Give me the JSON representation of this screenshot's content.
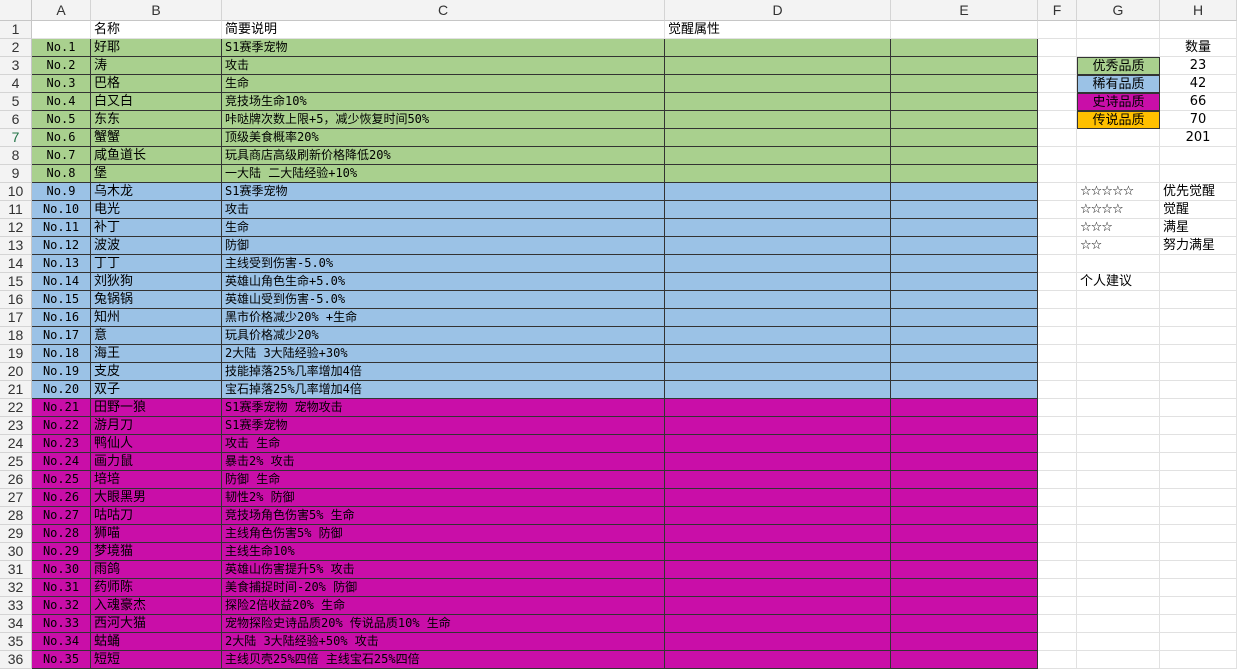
{
  "sheet": {
    "columns": [
      "A",
      "B",
      "C",
      "D",
      "E",
      "F",
      "G",
      "H"
    ],
    "row_numbers": [
      "1",
      "2",
      "3",
      "4",
      "5",
      "6",
      "7",
      "8",
      "9",
      "10",
      "11",
      "12",
      "13",
      "14",
      "15",
      "16",
      "17",
      "18",
      "19",
      "20",
      "21",
      "22",
      "23",
      "24",
      "25",
      "26",
      "27",
      "28",
      "29",
      "30",
      "31",
      "32",
      "33",
      "34",
      "35",
      "36"
    ],
    "selected_row": "7",
    "headers": {
      "name": "名称",
      "desc": "简要说明",
      "awaken": "觉醒属性"
    },
    "colors": {
      "green": "#a9d08e",
      "blue": "#9bc2e6",
      "magenta": "#c90ea8",
      "orange": "#ffc000"
    },
    "pets": [
      {
        "no": "No.1",
        "name": "好耶",
        "desc": "S1赛季宠物",
        "quality": "green"
      },
      {
        "no": "No.2",
        "name": "涛",
        "desc": "攻击",
        "quality": "green"
      },
      {
        "no": "No.3",
        "name": "巴格",
        "desc": "生命",
        "quality": "green"
      },
      {
        "no": "No.4",
        "name": "白又白",
        "desc": "竞技场生命10%",
        "quality": "green"
      },
      {
        "no": "No.5",
        "name": "东东",
        "desc": "咔哒牌次数上限+5，减少恢复时间50%",
        "quality": "green"
      },
      {
        "no": "No.6",
        "name": "蟹蟹",
        "desc": "顶级美食概率20%",
        "quality": "green"
      },
      {
        "no": "No.7",
        "name": "咸鱼道长",
        "desc": "玩具商店高级刷新价格降低20%",
        "quality": "green"
      },
      {
        "no": "No.8",
        "name": "堡",
        "desc": "一大陆  二大陆经验+10%",
        "quality": "green"
      },
      {
        "no": "No.9",
        "name": "乌木龙",
        "desc": "S1赛季宠物",
        "quality": "blue"
      },
      {
        "no": "No.10",
        "name": "电光",
        "desc": "攻击",
        "quality": "blue"
      },
      {
        "no": "No.11",
        "name": "补丁",
        "desc": "生命",
        "quality": "blue"
      },
      {
        "no": "No.12",
        "name": "波波",
        "desc": "防御",
        "quality": "blue"
      },
      {
        "no": "No.13",
        "name": "丁丁",
        "desc": "主线受到伤害-5.0%",
        "quality": "blue"
      },
      {
        "no": "No.14",
        "name": "刘狄狗",
        "desc": "英雄山角色生命+5.0%",
        "quality": "blue"
      },
      {
        "no": "No.15",
        "name": "兔锅锅",
        "desc": "英雄山受到伤害-5.0%",
        "quality": "blue"
      },
      {
        "no": "No.16",
        "name": "知州",
        "desc": "黑市价格减少20%    +生命",
        "quality": "blue"
      },
      {
        "no": "No.17",
        "name": "意",
        "desc": "玩具价格减少20%",
        "quality": "blue"
      },
      {
        "no": "No.18",
        "name": "海王",
        "desc": "2大陆 3大陆经验+30%",
        "quality": "blue"
      },
      {
        "no": "No.19",
        "name": "支皮",
        "desc": "技能掉落25%几率增加4倍",
        "quality": "blue"
      },
      {
        "no": "No.20",
        "name": "双子",
        "desc": "宝石掉落25%几率增加4倍",
        "quality": "blue"
      },
      {
        "no": "No.21",
        "name": "田野一狼",
        "desc": "S1赛季宠物 宠物攻击",
        "quality": "magenta"
      },
      {
        "no": "No.22",
        "name": "游月刀",
        "desc": "S1赛季宠物",
        "quality": "magenta"
      },
      {
        "no": "No.23",
        "name": "鸭仙人",
        "desc": "攻击   生命",
        "quality": "magenta"
      },
      {
        "no": "No.24",
        "name": "画力鼠",
        "desc": "暴击2%   攻击",
        "quality": "magenta"
      },
      {
        "no": "No.25",
        "name": "培培",
        "desc": "防御  生命",
        "quality": "magenta"
      },
      {
        "no": "No.26",
        "name": "大眼黑男",
        "desc": "韧性2%  防御",
        "quality": "magenta"
      },
      {
        "no": "No.27",
        "name": "咕咕刀",
        "desc": "竞技场角色伤害5%  生命",
        "quality": "magenta"
      },
      {
        "no": "No.28",
        "name": "狮喵",
        "desc": "主线角色伤害5%  防御",
        "quality": "magenta"
      },
      {
        "no": "No.29",
        "name": "梦境猫",
        "desc": "主线生命10%",
        "quality": "magenta"
      },
      {
        "no": "No.30",
        "name": "雨鸽",
        "desc": "英雄山伤害提升5%  攻击",
        "quality": "magenta"
      },
      {
        "no": "No.31",
        "name": "药师陈",
        "desc": "美食捕捉时间-20%    防御",
        "quality": "magenta"
      },
      {
        "no": "No.32",
        "name": "入魂豪杰",
        "desc": "探险2倍收益20%   生命",
        "quality": "magenta"
      },
      {
        "no": "No.33",
        "name": "西河大猫",
        "desc": "宠物探险史诗品质20% 传说品质10%  生命",
        "quality": "magenta"
      },
      {
        "no": "No.34",
        "name": "蛄蛹",
        "desc": "2大陆 3大陆经验+50% 攻击",
        "quality": "magenta"
      },
      {
        "no": "No.35",
        "name": "短短",
        "desc": "主线贝壳25%四倍  主线宝石25%四倍",
        "quality": "magenta"
      }
    ],
    "summary": {
      "count_header": "数量",
      "qualities": [
        {
          "label": "优秀品质",
          "count": "23",
          "color": "green"
        },
        {
          "label": "稀有品质",
          "count": "42",
          "color": "blue"
        },
        {
          "label": "史诗品质",
          "count": "66",
          "color": "magenta"
        },
        {
          "label": "传说品质",
          "count": "70",
          "color": "orange"
        }
      ],
      "total": "201"
    },
    "stars": [
      {
        "stars": "☆☆☆☆☆",
        "label": "优先觉醒"
      },
      {
        "stars": "☆☆☆☆",
        "label": "觉醒"
      },
      {
        "stars": "☆☆☆",
        "label": "满星"
      },
      {
        "stars": "☆☆",
        "label": "努力满星"
      }
    ],
    "advice_label": "个人建议"
  }
}
